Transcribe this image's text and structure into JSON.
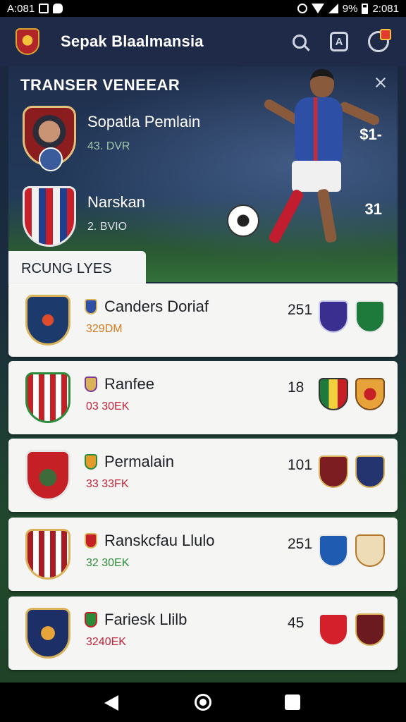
{
  "status_bar": {
    "time_left": "A:081",
    "battery_text": "9%",
    "time_right": "2:081"
  },
  "header": {
    "title": "Sepak Blaalmansia",
    "profile_letter": "A"
  },
  "banner": {
    "title": "TRANSER VENEEAR",
    "players": [
      {
        "name": "Sopatla Pemlain",
        "value": "43. DVR",
        "side_value": "$1-"
      },
      {
        "name": "Narskan",
        "value": "2. BVIO",
        "side_value": "31"
      }
    ]
  },
  "section": {
    "tab_label": "RCUNG LYES"
  },
  "clubs": [
    {
      "name": "Canders Doriaf",
      "value": "329DM",
      "value_color": "#d27a1f",
      "score": "251",
      "opponents": [
        "purple-crest",
        "green-crest"
      ]
    },
    {
      "name": "Ranfee",
      "value": "03 30EK",
      "value_color": "#c2233a",
      "score": "18",
      "opponents": [
        "tricolor-crest",
        "amber-crest"
      ]
    },
    {
      "name": "Permalain",
      "value": "33 33FK",
      "value_color": "#c2233a",
      "score": "101",
      "opponents": [
        "maroon-crest",
        "navy-crest"
      ]
    },
    {
      "name": "Ranskcfau Llulo",
      "value": "32 30EK",
      "value_color": "#2d8a3a",
      "score": "251",
      "opponents": [
        "blue-crest",
        "tan-crest"
      ]
    },
    {
      "name": "Fariesk Llilb",
      "value": "3240EK",
      "value_color": "#c2233a",
      "score": "45",
      "opponents": [
        "red-crest",
        "darkred-crest"
      ]
    }
  ]
}
